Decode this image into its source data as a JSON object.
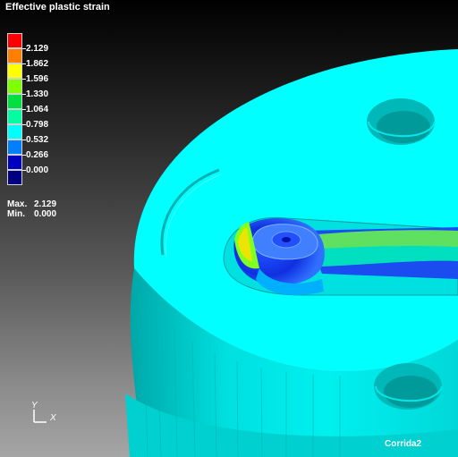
{
  "title": "Effective plastic strain",
  "legend": {
    "levels": [
      {
        "value": "2.129",
        "color": "#ff0000"
      },
      {
        "value": "1.862",
        "color": "#ff8000"
      },
      {
        "value": "1.596",
        "color": "#ffff00"
      },
      {
        "value": "1.330",
        "color": "#80ff00"
      },
      {
        "value": "1.064",
        "color": "#00e040"
      },
      {
        "value": "0.798",
        "color": "#00ffa0"
      },
      {
        "value": "0.532",
        "color": "#00ffff"
      },
      {
        "value": "0.266",
        "color": "#0080ff"
      },
      {
        "value": "0.000",
        "color": "#0000c0"
      },
      {
        "value": "",
        "color": "#000080"
      }
    ]
  },
  "stats": {
    "max_label": "Max.",
    "max_value": "2.129",
    "min_label": "Min.",
    "min_value": "0.000"
  },
  "axes": {
    "y_label": "Y",
    "x_label": "X"
  },
  "run_name": "Corrida2",
  "colors": {
    "part_surface": "#00ffff",
    "part_shadow": "#00c8c8"
  }
}
